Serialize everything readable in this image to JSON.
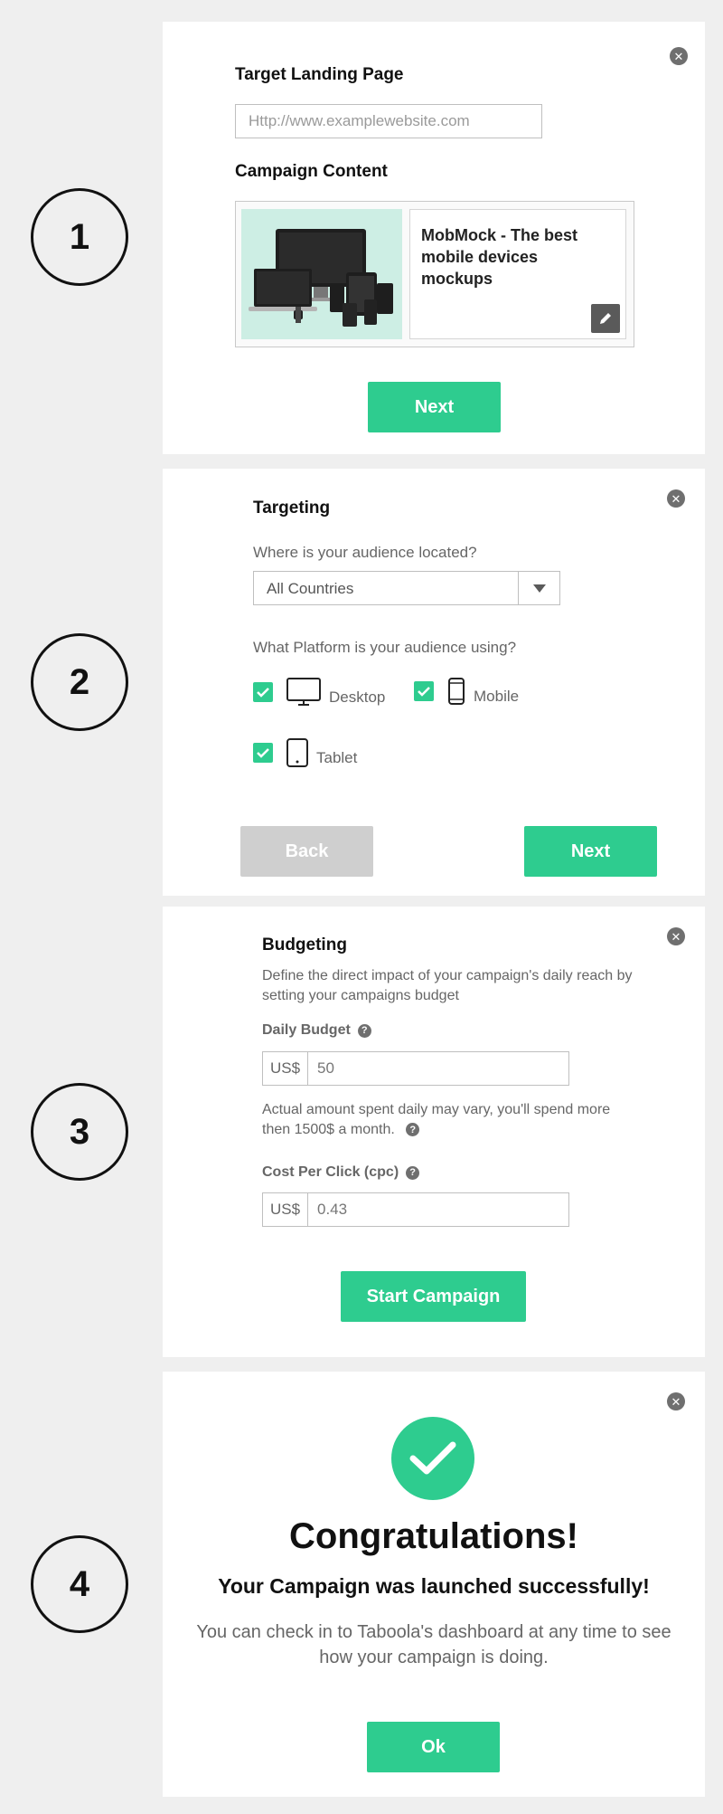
{
  "steps": [
    "1",
    "2",
    "3",
    "4"
  ],
  "step1": {
    "landing_label": "Target Landing Page",
    "landing_placeholder": "Http://www.examplewebsite.com",
    "content_label": "Campaign Content",
    "content_title": "MobMock - The best mobile devices mockups",
    "next_label": "Next"
  },
  "step2": {
    "title": "Targeting",
    "location_question": "Where is your audience located?",
    "country_value": "All Countries",
    "platform_question": "What Platform is your audience using?",
    "platforms": [
      "Desktop",
      "Mobile",
      "Tablet"
    ],
    "back_label": "Back",
    "next_label": "Next"
  },
  "step3": {
    "title": "Budgeting",
    "description": "Define the direct impact of your campaign's daily reach by setting your campaigns budget",
    "daily_budget_label": "Daily Budget",
    "currency": "US$",
    "daily_budget_value": "50",
    "note": "Actual amount spent daily may vary, you'll spend more then 1500$ a month.",
    "cpc_label": "Cost Per Click (cpc)",
    "cpc_value": "0.43",
    "start_label": "Start Campaign"
  },
  "step4": {
    "title": "Congratulations!",
    "subtitle": "Your Campaign was launched successfully!",
    "message": "You can check in to Taboola's dashboard at any time to see how your campaign is doing.",
    "ok_label": "Ok"
  },
  "icons": {
    "close": "close-icon",
    "help": "question-icon",
    "check": "check-icon",
    "edit": "pencil-icon",
    "dropdown": "caret-down-icon",
    "desktop": "desktop-icon",
    "mobile": "mobile-icon",
    "tablet": "tablet-icon"
  },
  "colors": {
    "accent": "#2ecc8f",
    "disabled": "#cfcfcf",
    "background": "#efefef"
  }
}
